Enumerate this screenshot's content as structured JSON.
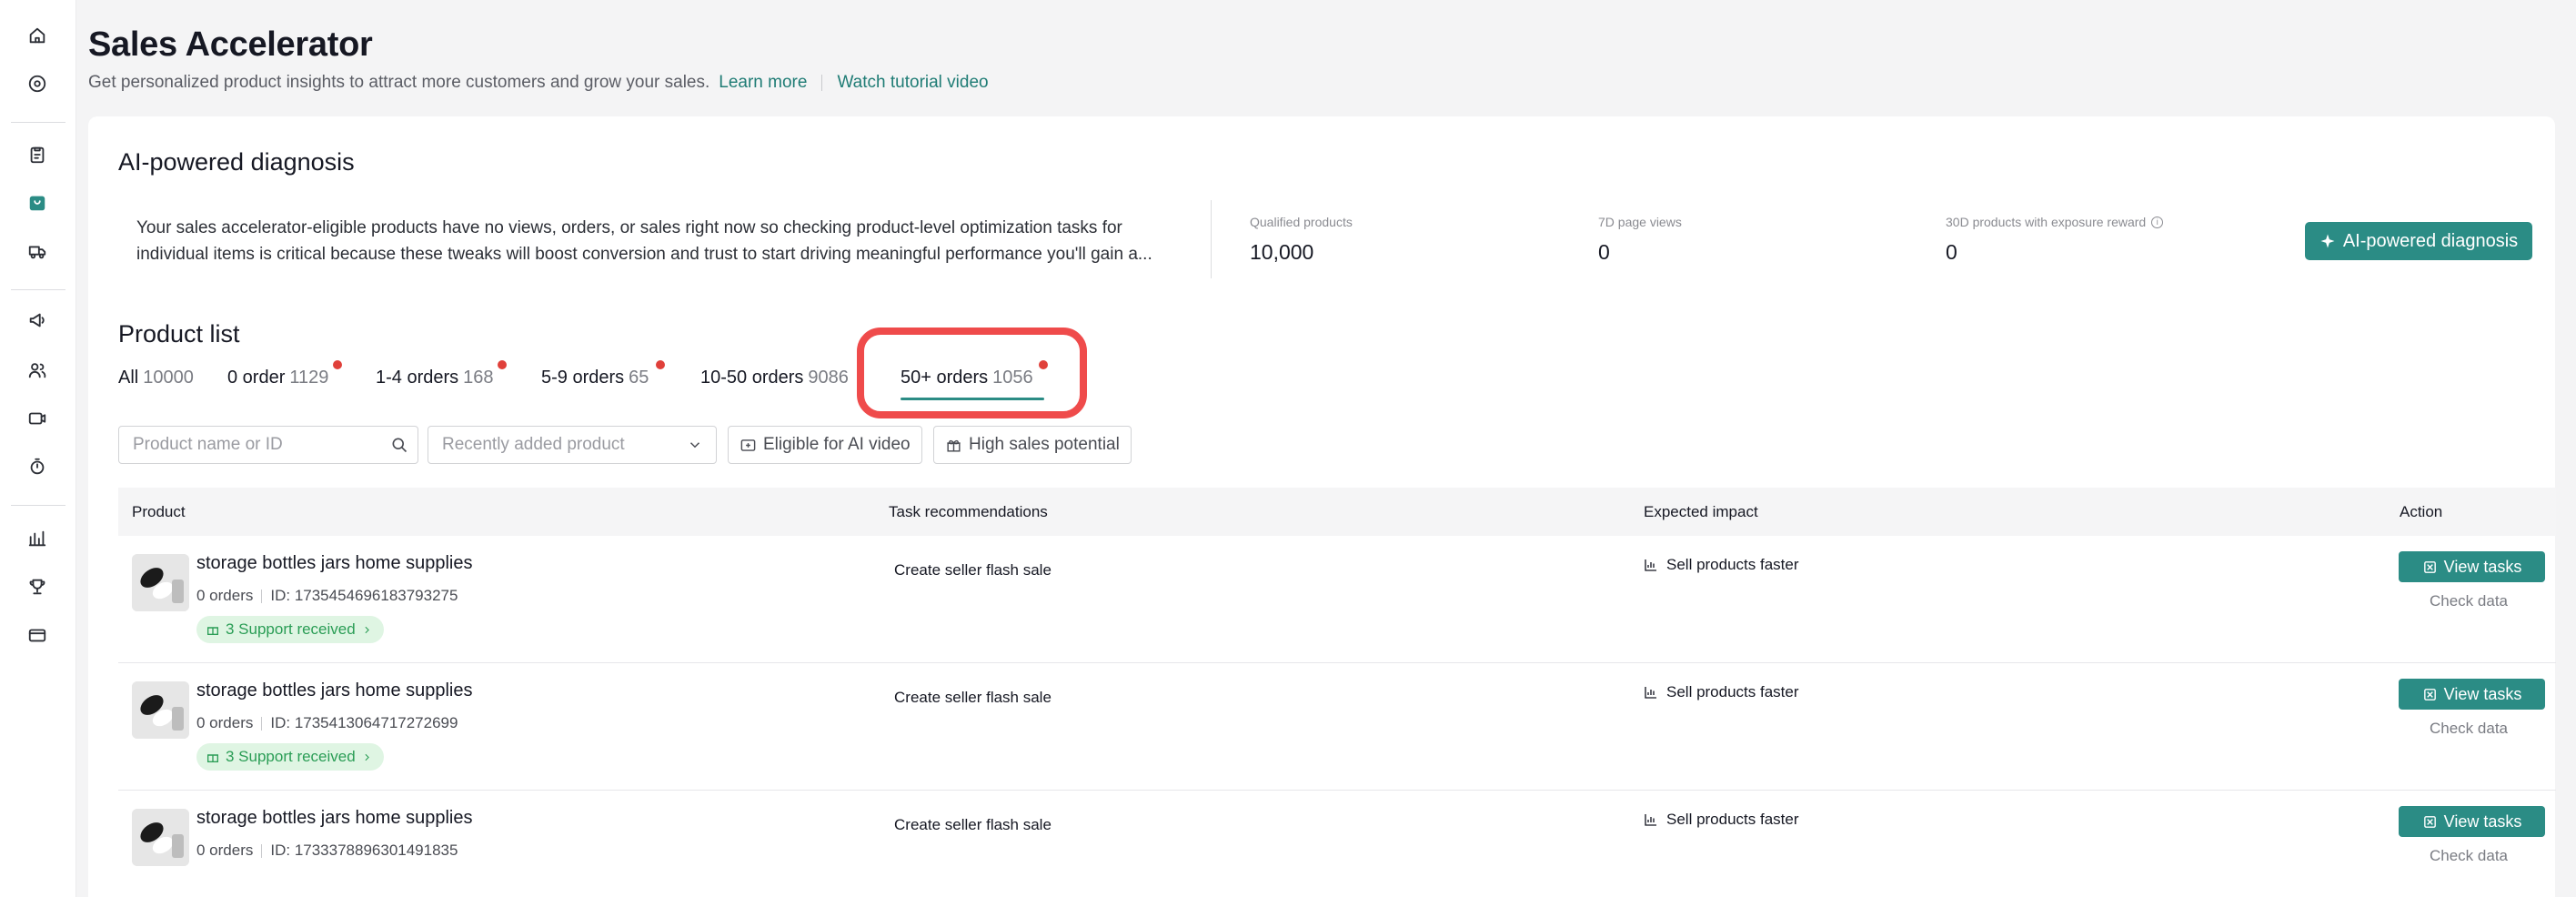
{
  "header": {
    "title": "Sales Accelerator",
    "subtitle": "Get personalized product insights to attract more customers and grow your sales.",
    "learn_more": "Learn more",
    "tutorial": "Watch tutorial video"
  },
  "diagnosis": {
    "title": "AI-powered diagnosis",
    "text_line1": "Your sales accelerator-eligible products have no views, orders, or sales right now so checking product-level optimization tasks for",
    "text_line2": "individual items is critical because these tweaks will boost conversion and trust to start driving meaningful performance you'll gain a...",
    "metrics": [
      {
        "label": "Qualified products",
        "value": "10,000"
      },
      {
        "label": "7D page views",
        "value": "0"
      },
      {
        "label": "30D products with exposure reward",
        "value": "0"
      }
    ],
    "button_label": "AI-powered diagnosis"
  },
  "product_list": {
    "title": "Product list",
    "tabs": [
      {
        "name": "All",
        "count": "10000"
      },
      {
        "name": "0 order",
        "count": "1129"
      },
      {
        "name": "1-4 orders",
        "count": "168"
      },
      {
        "name": "5-9 orders",
        "count": "65"
      },
      {
        "name": "10-50 orders",
        "count": "9086"
      },
      {
        "name": "50+ orders",
        "count": "1056"
      }
    ],
    "search_placeholder": "Product name or ID",
    "sort_placeholder": "Recently added product",
    "filters": [
      "Eligible for AI video",
      "High sales potential"
    ],
    "columns": [
      "Product",
      "Task recommendations",
      "Expected impact",
      "Action"
    ],
    "rows": [
      {
        "name": "storage bottles jars home supplies",
        "orders": "0 orders",
        "id": "ID: 1735454696183793275",
        "support": "3 Support received",
        "task": "Create seller flash sale",
        "impact": "Sell products faster",
        "action": "View tasks",
        "check": "Check data"
      },
      {
        "name": "storage bottles jars home supplies",
        "orders": "0 orders",
        "id": "ID: 1735413064717272699",
        "support": "3 Support received",
        "task": "Create seller flash sale",
        "impact": "Sell products faster",
        "action": "View tasks",
        "check": "Check data"
      },
      {
        "name": "storage bottles jars home supplies",
        "orders": "0 orders",
        "id": "ID: 1733378896301491835",
        "task": "Create seller flash sale",
        "impact": "Sell products faster",
        "action": "View tasks",
        "check": "Check data"
      }
    ]
  },
  "colors": {
    "accent": "#2b8c85",
    "highlight": "#ef4b4b",
    "dot": "#e0403a",
    "support_bg": "#dff5e3"
  }
}
